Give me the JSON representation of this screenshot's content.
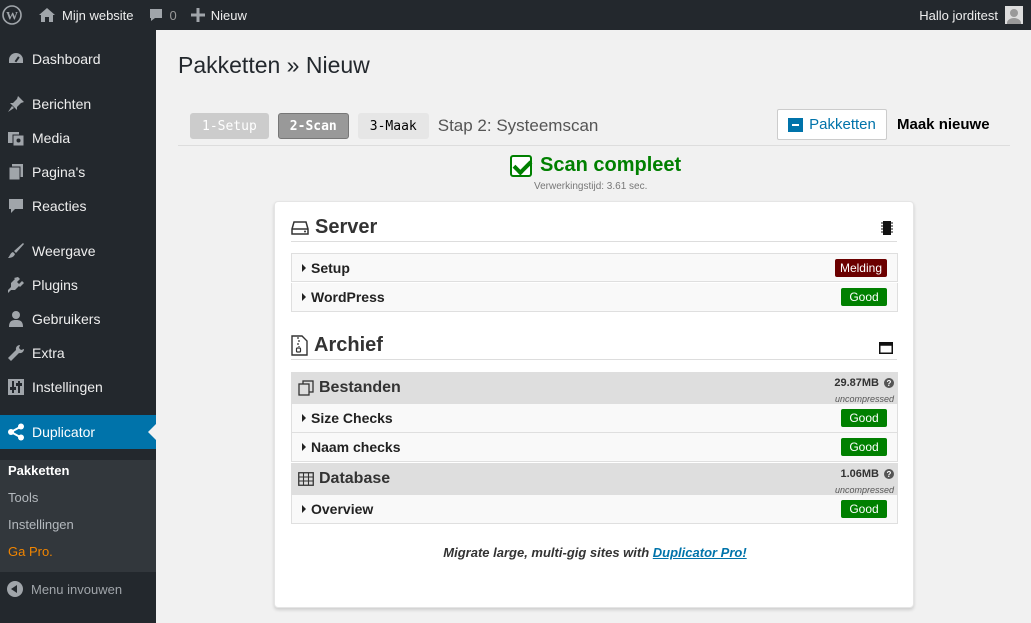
{
  "adminbar": {
    "site_name": "Mijn website",
    "comments_count": "0",
    "new_label": "Nieuw",
    "greeting": "Hallo jorditest"
  },
  "sidebar": {
    "items": [
      {
        "label": "Dashboard",
        "icon": "dashboard-icon"
      },
      {
        "label": "Berichten",
        "icon": "pin-icon"
      },
      {
        "label": "Media",
        "icon": "media-icon"
      },
      {
        "label": "Pagina's",
        "icon": "pages-icon"
      },
      {
        "label": "Reacties",
        "icon": "comment-icon"
      },
      {
        "label": "Weergave",
        "icon": "brush-icon"
      },
      {
        "label": "Plugins",
        "icon": "plugin-icon"
      },
      {
        "label": "Gebruikers",
        "icon": "user-icon"
      },
      {
        "label": "Extra",
        "icon": "wrench-icon"
      },
      {
        "label": "Instellingen",
        "icon": "settings-icon"
      },
      {
        "label": "Duplicator",
        "icon": "share-icon"
      }
    ],
    "submenu": [
      "Pakketten",
      "Tools",
      "Instellingen",
      "Ga Pro."
    ],
    "collapse_label": "Menu invouwen"
  },
  "main": {
    "title": "Pakketten » Nieuw",
    "steps": [
      "1-Setup",
      "2-Scan",
      "3-Maak"
    ],
    "step_caption": "Stap 2: Systeemscan",
    "packages_button": "Pakketten",
    "make_new": "Maak nieuwe",
    "scan_title": "Scan compleet",
    "scan_time": "Verwerkingstijd: 3.61 sec.",
    "server": {
      "title": "Server",
      "rows": [
        {
          "label": "Setup",
          "status": "Melding"
        },
        {
          "label": "WordPress",
          "status": "Good"
        }
      ]
    },
    "archive": {
      "title": "Archief",
      "files": {
        "title": "Bestanden",
        "size": "29.87MB",
        "note": "uncompressed"
      },
      "file_rows": [
        {
          "label": "Size Checks",
          "status": "Good"
        },
        {
          "label": "Naam checks",
          "status": "Good"
        }
      ],
      "database": {
        "title": "Database",
        "size": "1.06MB",
        "note": "uncompressed"
      },
      "db_rows": [
        {
          "label": "Overview",
          "status": "Good"
        }
      ]
    },
    "promo_text": "Migrate large, multi-gig sites with ",
    "promo_link": "Duplicator Pro!"
  },
  "colors": {
    "accent": "#0073aa",
    "good": "#008000",
    "warning": "#6b0000",
    "pro": "#f18500"
  }
}
